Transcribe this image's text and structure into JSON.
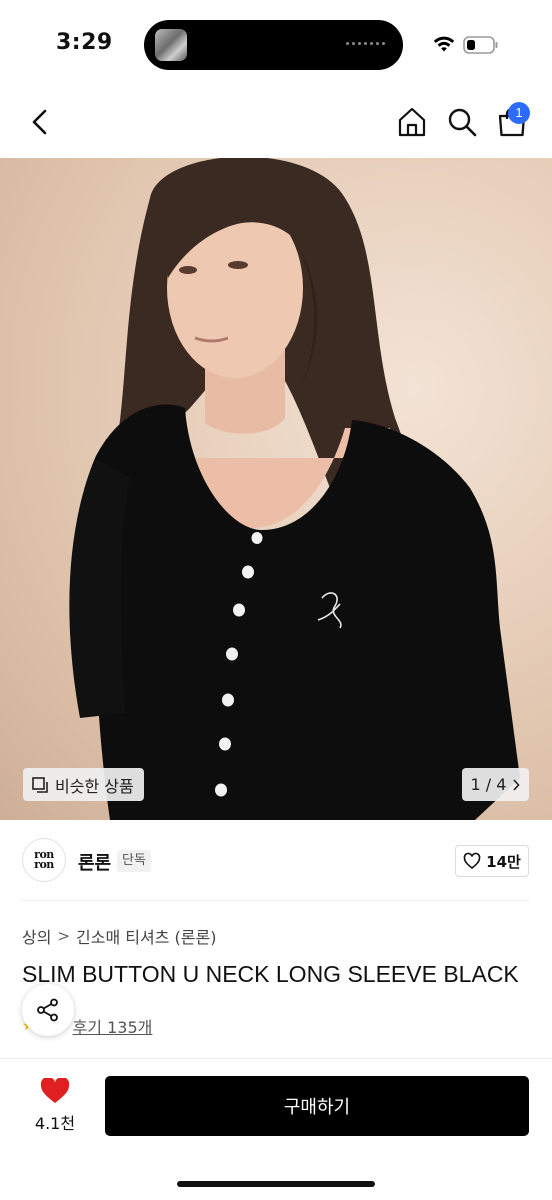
{
  "status_bar": {
    "time": "3:29"
  },
  "nav": {
    "cart_count": "1"
  },
  "hero": {
    "similar_label": "비슷한 상품",
    "page_indicator": "1 / 4"
  },
  "brand": {
    "logo_line1": "ron",
    "logo_line2": "ron",
    "name": "론론",
    "tag": "단독",
    "like_count": "14만"
  },
  "breadcrumb": {
    "level1": "상의",
    "separator": ">",
    "level2": "긴소매 티셔츠 (론론)"
  },
  "product": {
    "title": "SLIM BUTTON U NECK LONG SLEEVE BLACK"
  },
  "reviews": {
    "link": "후기 135개"
  },
  "bottom_bar": {
    "wish_count": "4.1천",
    "buy_label": "구매하기"
  },
  "colors": {
    "accent_blue": "#2b6cff",
    "wish_red": "#e02020",
    "button_black": "#000000"
  }
}
